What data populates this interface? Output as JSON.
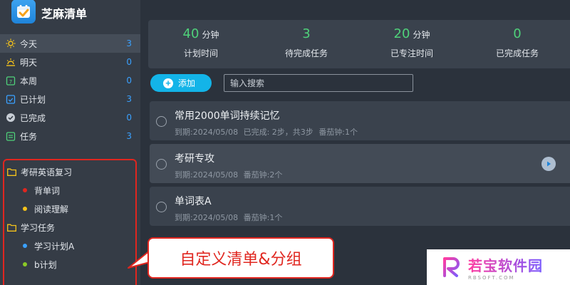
{
  "app": {
    "title": "芝麻清单"
  },
  "nav": [
    {
      "label": "今天",
      "count": "3",
      "icon": "sun-icon",
      "active": true
    },
    {
      "label": "明天",
      "count": "0",
      "icon": "sunrise-icon"
    },
    {
      "label": "本周",
      "count": "0",
      "icon": "calendar-week-icon"
    },
    {
      "label": "已计划",
      "count": "3",
      "icon": "calendar-check-icon"
    },
    {
      "label": "已完成",
      "count": "0",
      "icon": "check-circle-icon"
    },
    {
      "label": "任务",
      "count": "3",
      "icon": "task-list-icon"
    }
  ],
  "groups": [
    {
      "name": "考研英语复习",
      "lists": [
        {
          "name": "背单词",
          "color": "#e0261f"
        },
        {
          "name": "阅读理解",
          "color": "#f4c21b"
        }
      ]
    },
    {
      "name": "学习任务",
      "lists": [
        {
          "name": "学习计划A",
          "color": "#3aa1ff"
        },
        {
          "name": "b计划",
          "color": "#8ac926"
        }
      ]
    }
  ],
  "stats": [
    {
      "value": "40",
      "unit": "分钟",
      "label": "计划时间"
    },
    {
      "value": "3",
      "unit": "",
      "label": "待完成任务"
    },
    {
      "value": "20",
      "unit": "分钟",
      "label": "已专注时间"
    },
    {
      "value": "0",
      "unit": "",
      "label": "已完成任务"
    }
  ],
  "toolbar": {
    "add_label": "添加",
    "search_placeholder": "输入搜索"
  },
  "tasks": [
    {
      "title": "常用2000单词持续记忆",
      "meta": [
        "到期:2024/05/08",
        "已完成: 2步，共3步",
        "番茄钟:1个"
      ]
    },
    {
      "title": "考研专攻",
      "meta": [
        "到期:2024/05/08",
        "番茄钟:2个"
      ]
    },
    {
      "title": "单词表A",
      "meta": [
        "到期:2024/05/08",
        "番茄钟:1个"
      ]
    }
  ],
  "callout": {
    "text": "自定义清单&分组"
  },
  "watermark": {
    "main": "若宝软件园",
    "sub": "RBSOFT.COM"
  },
  "colors": {
    "accent": "#13b4e8",
    "stat_green": "#4fd17a",
    "count_blue": "#3aa1ff",
    "highlight_red": "#e0261f"
  }
}
